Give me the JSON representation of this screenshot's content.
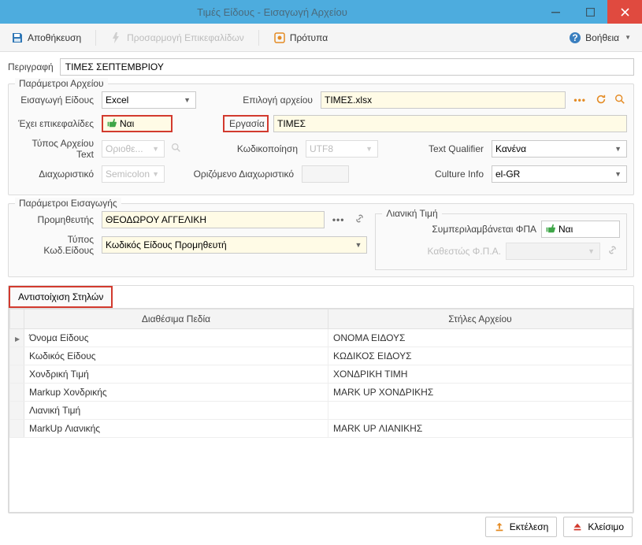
{
  "window": {
    "title": "Τιμές Είδους - Εισαγωγή Αρχείου"
  },
  "toolbar": {
    "save": "Αποθήκευση",
    "adaptHeaders": "Προσαρμογή Επικεφαλίδων",
    "templates": "Πρότυπα",
    "help": "Βοήθεια"
  },
  "description": {
    "label": "Περιγραφή",
    "value": "ΤΙΜΕΣ ΣΕΠΤΕΜΒΡΙΟΥ"
  },
  "fileParams": {
    "title": "Παράμετροι Αρχείου",
    "importTypeLabel": "Εισαγωγή Είδους",
    "importType": "Excel",
    "fileSelectLabel": "Επιλογή αρχείου",
    "file": "ΤΙΜΕΣ.xlsx",
    "hasHeadersLabel": "Έχει επικεφαλίδες",
    "hasHeaders": "Ναι",
    "taskLabel": "Εργασία",
    "task": "ΤΙΜΕΣ",
    "textTypeLabel": "Τύπος Αρχείου Text",
    "textType": "Οριοθε...",
    "encodingLabel": "Κωδικοποίηση",
    "encoding": "UTF8",
    "textQualifierLabel": "Text Qualifier",
    "textQualifier": "Κανένα",
    "delimiterLabel": "Διαχωριστικό",
    "delimiter": "Semicolon",
    "customDelimLabel": "Οριζόμενο Διαχωριστικό",
    "customDelim": "",
    "cultureLabel": "Culture Info",
    "culture": "el-GR"
  },
  "importParams": {
    "title": "Παράμετροι Εισαγωγής",
    "supplierLabel": "Προμηθευτής",
    "supplier": "ΘΕΟΔΩΡΟΥ ΑΓΓΕΛΙΚΗ",
    "codeTypeLabel": "Τύπος Κωδ.Είδους",
    "codeType": "Κωδικός Είδους Προμηθευτή",
    "retailTitle": "Λιανική Τιμή",
    "vatIncludedLabel": "Συμπεριλαμβάνεται ΦΠΑ",
    "vatIncluded": "Ναι",
    "vatRateLabel": "Καθεστώς Φ.Π.Α."
  },
  "mapping": {
    "tab": "Αντιστοίχιση Στηλών",
    "headers": {
      "available": "Διαθέσιμα Πεδία",
      "fileCols": "Στήλες Αρχείου"
    },
    "rows": [
      {
        "avail": "Όνομα Είδους",
        "file": "ΟΝΟΜΑ ΕΙΔΟΥΣ"
      },
      {
        "avail": "Κωδικός Είδους",
        "file": "ΚΩΔΙΚΟΣ ΕΙΔΟΥΣ"
      },
      {
        "avail": "Χονδρική Τιμή",
        "file": "ΧΟΝΔΡΙΚΗ ΤΙΜΗ"
      },
      {
        "avail": "Markup Χονδρικής",
        "file": "MARK UP ΧΟΝΔΡΙΚΗΣ"
      },
      {
        "avail": "Λιανική Τιμή",
        "file": ""
      },
      {
        "avail": "MarkUp Λιανικής",
        "file": "MARK UP ΛΙΑΝΙΚΗΣ"
      }
    ]
  },
  "footer": {
    "execute": "Εκτέλεση",
    "close": "Κλείσιμο"
  }
}
